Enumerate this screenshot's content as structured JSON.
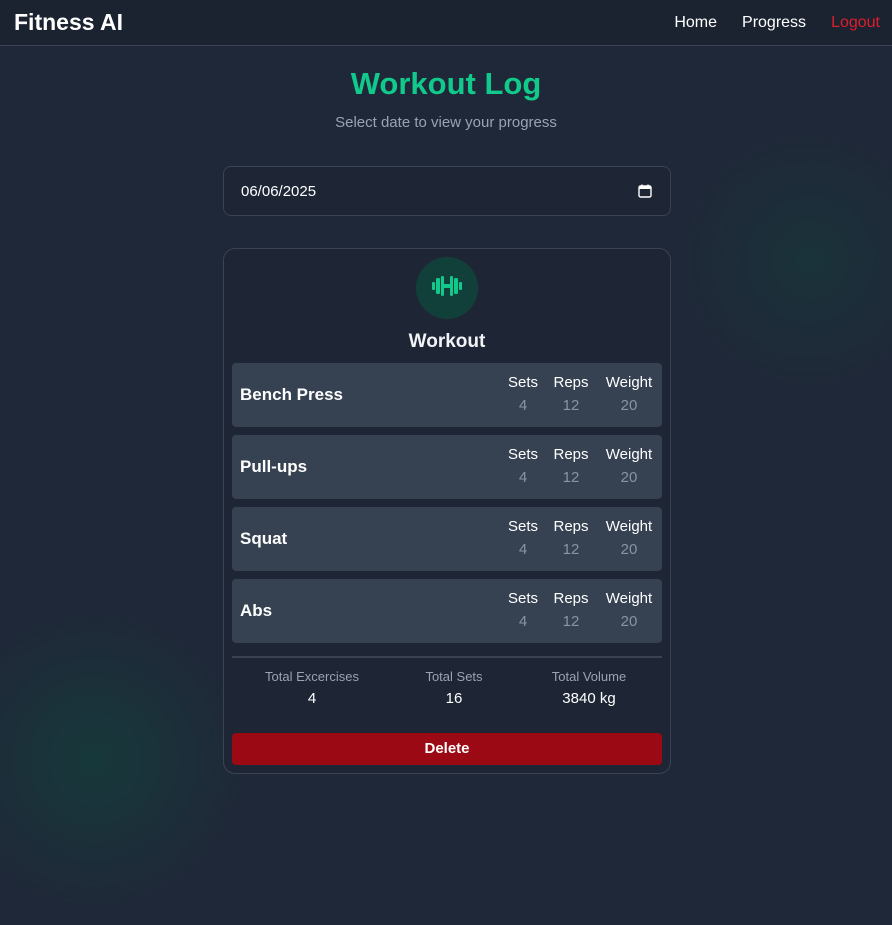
{
  "nav": {
    "brand": "Fitness AI",
    "links": [
      {
        "label": "Home"
      },
      {
        "label": "Progress"
      },
      {
        "label": "Logout"
      }
    ]
  },
  "header": {
    "title": "Workout Log",
    "subtitle": "Select date to view your progress"
  },
  "date_picker": {
    "value": "06/06/2025"
  },
  "workout": {
    "title": "Workout",
    "stat_labels": {
      "sets": "Sets",
      "reps": "Reps",
      "weight": "Weight"
    },
    "exercises": [
      {
        "name": "Bench Press",
        "sets": "4",
        "reps": "12",
        "weight": "20"
      },
      {
        "name": "Pull-ups",
        "sets": "4",
        "reps": "12",
        "weight": "20"
      },
      {
        "name": "Squat",
        "sets": "4",
        "reps": "12",
        "weight": "20"
      },
      {
        "name": "Abs",
        "sets": "4",
        "reps": "12",
        "weight": "20"
      }
    ],
    "totals": {
      "exercises_label": "Total Excercises",
      "exercises_value": "4",
      "sets_label": "Total Sets",
      "sets_value": "16",
      "volume_label": "Total Volume",
      "volume_value": "3840 kg"
    },
    "delete_label": "Delete"
  },
  "colors": {
    "accent": "#10c98a",
    "danger": "#9b0a14",
    "logout": "#e11d2b",
    "background": "#1f2838",
    "row": "#364152"
  },
  "icons": {
    "workout": "dumbbell-icon",
    "date": "calendar-icon"
  }
}
